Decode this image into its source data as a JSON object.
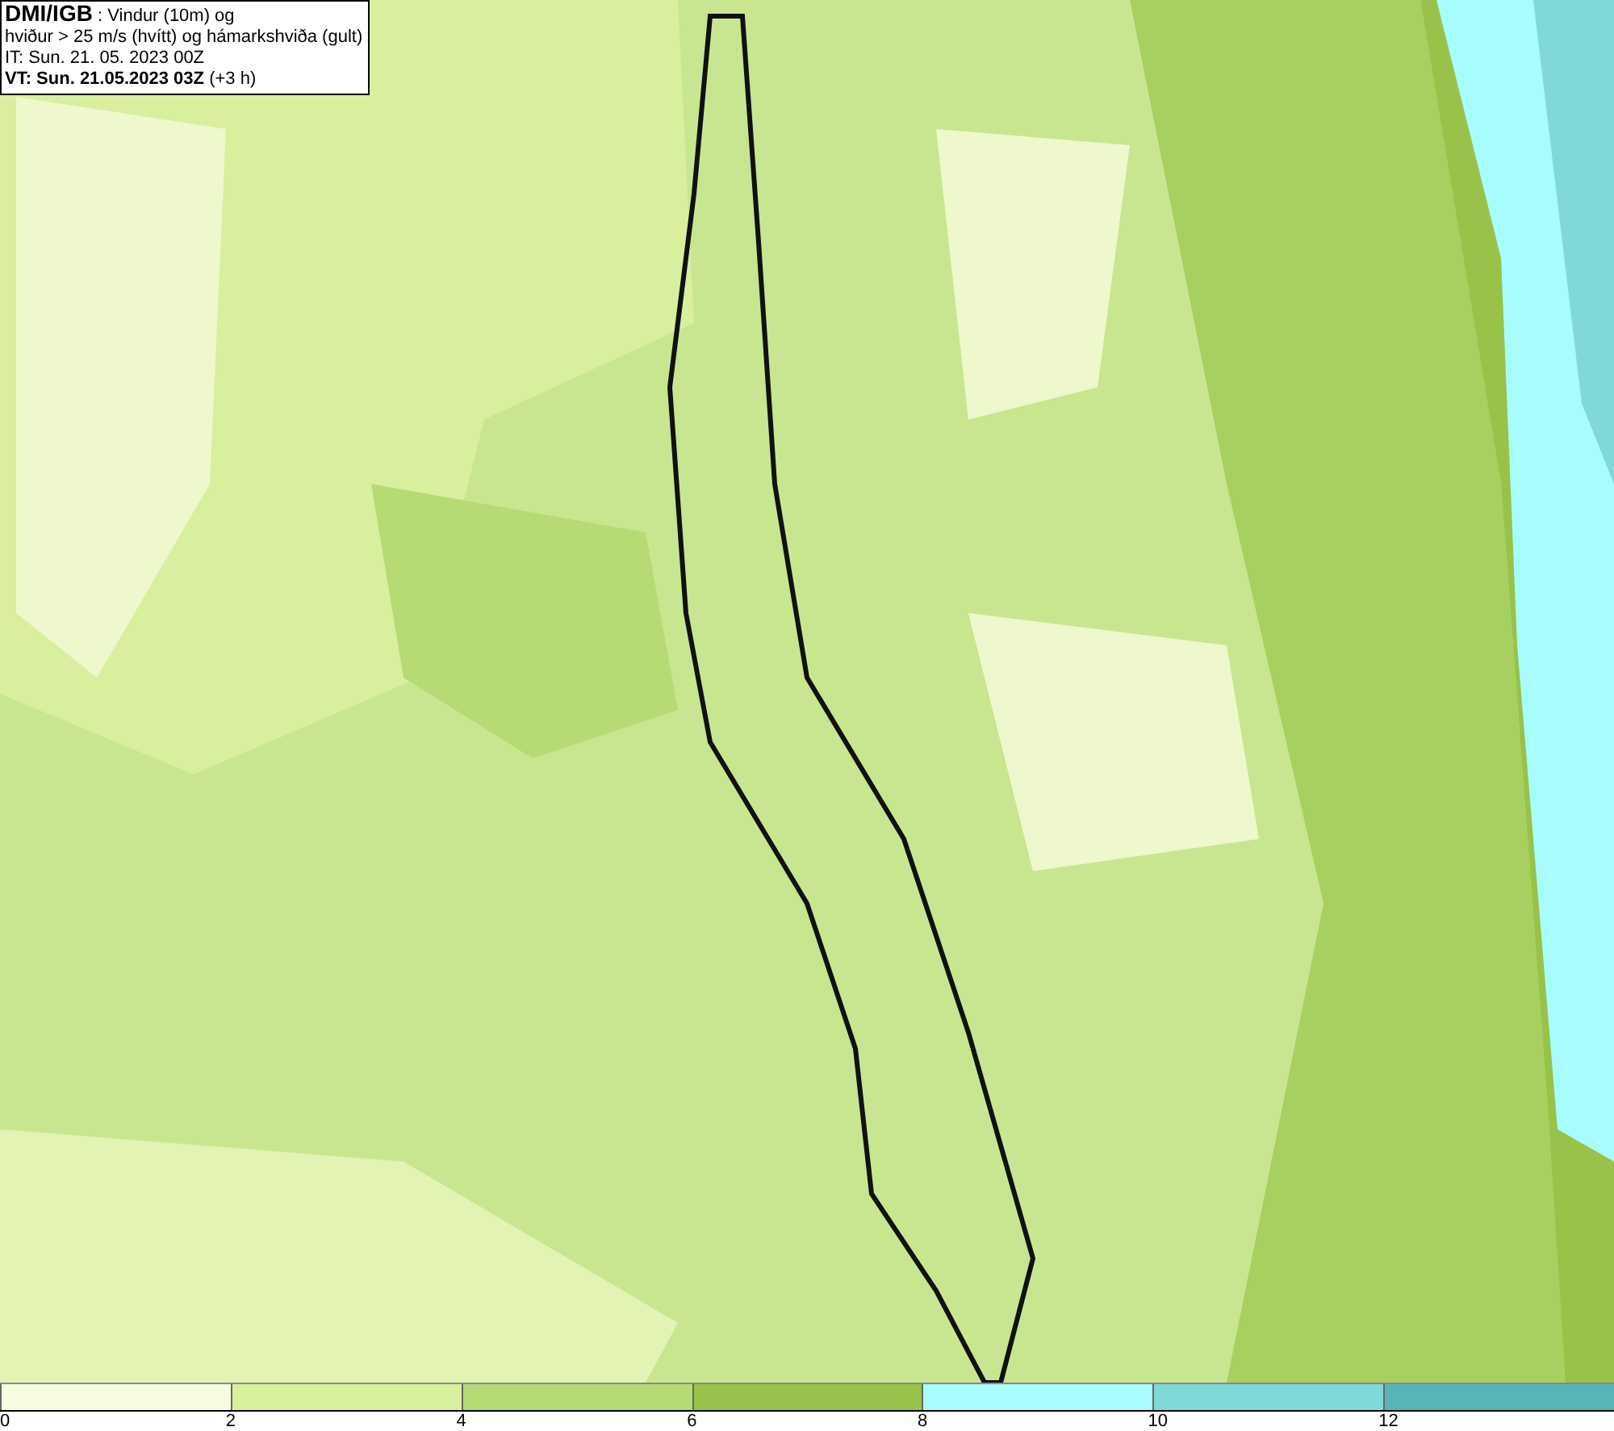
{
  "legend": {
    "lines": [
      "**DMI/IGB** : Vindur (10m) og",
      "hviður > 25 m/s (hvítt) og hámarkshviða (gult)",
      "IT: Sun. 21. 05. 2023 00Z",
      "**VT: Sun. 21.05.2023 03Z** (+3 h)"
    ]
  },
  "colorbar": [
    {
      "label": "0",
      "color": "#f5fce0"
    },
    {
      "label": "2",
      "color": "#d6f09c"
    },
    {
      "label": "4",
      "color": "#b6da74"
    },
    {
      "label": "6",
      "color": "#98c248"
    },
    {
      "label": "8",
      "color": "#a8fcfc"
    },
    {
      "label": "10",
      "color": "#80d8d8"
    },
    {
      "label": "12",
      "color": "#58b4b8"
    }
  ]
}
